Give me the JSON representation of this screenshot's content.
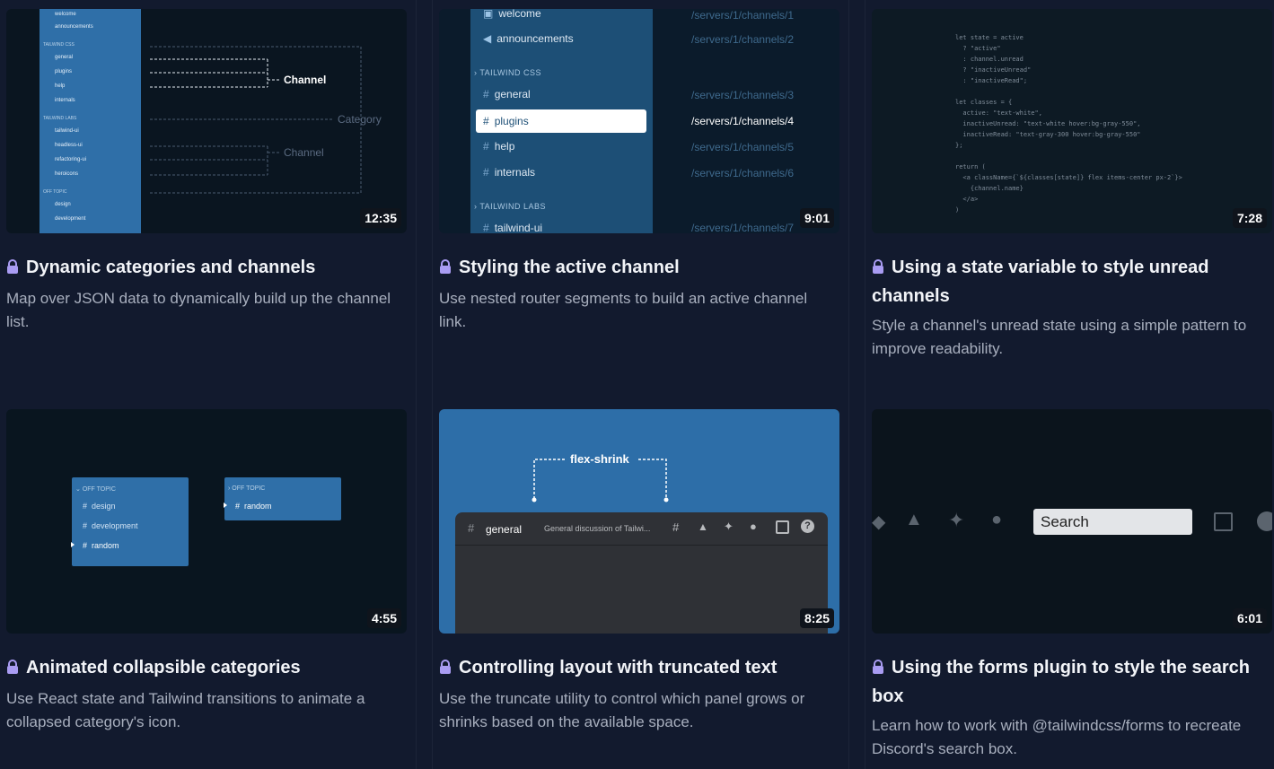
{
  "cards": [
    {
      "duration": "12:35",
      "title": "Dynamic categories and channels",
      "description": "Map over JSON data to dynamically build up the channel list.",
      "thumb": {
        "items": [
          "welcome",
          "announcements",
          "TAILWIND CSS",
          "general",
          "plugins",
          "help",
          "internals",
          "TAILWIND LABS",
          "tailwind-ui",
          "headless-ui",
          "refactoring-ui",
          "heroicons",
          "OFF TOPIC",
          "design",
          "development"
        ],
        "label_channel_1": "Channel",
        "label_category": "Category",
        "label_channel_2": "Channel"
      }
    },
    {
      "duration": "9:01",
      "title": "Styling the active channel",
      "description": "Use nested router segments to build an active channel link.",
      "thumb": {
        "welcome": "welcome",
        "announcements": "announcements",
        "cat1": "TAILWIND CSS",
        "general": "general",
        "plugins": "plugins",
        "help": "help",
        "internals": "internals",
        "cat2": "TAILWIND LABS",
        "tailwind_ui": "tailwind-ui",
        "paths": [
          "/servers/1/channels/1",
          "/servers/1/channels/2",
          "/servers/1/channels/3",
          "/servers/1/channels/4",
          "/servers/1/channels/5",
          "/servers/1/channels/6",
          "/servers/1/channels/7"
        ]
      }
    },
    {
      "duration": "7:28",
      "title": "Using a state variable to style unread channels",
      "description": "Style a channel's unread state using a simple pattern to improve readability.",
      "thumb": {
        "code": [
          "let state = active",
          "  ? \"active\"",
          "  : channel.unread",
          "  ? \"inactiveUnread\"",
          "  : \"inactiveRead\";",
          "",
          "let classes = {",
          "  active: \"text-white\",",
          "  inactiveUnread: \"text-white hover:bg-gray-550\",",
          "  inactiveRead: \"text-gray-300 hover:bg-gray-550\"",
          "};",
          "",
          "return (",
          "  <a className={`${classes[state]} flex items-center px-2`}>",
          "    {channel.name}",
          "  </a>",
          ")"
        ]
      }
    },
    {
      "duration": "4:55",
      "title": "Animated collapsible categories",
      "description": "Use React state and Tailwind transitions to animate a collapsed category's icon.",
      "thumb": {
        "cat": "OFF TOPIC",
        "items": [
          "design",
          "development",
          "random"
        ],
        "cat_collapsed": "OFF TOPIC",
        "collapsed_item": "random"
      }
    },
    {
      "duration": "8:25",
      "title": "Controlling layout with truncated text",
      "description": "Use the truncate utility to control which panel grows or shrinks based on the available space.",
      "thumb": {
        "label": "flex-shrink",
        "channel": "general",
        "topic": "General discussion of Tailwi..."
      }
    },
    {
      "duration": "6:01",
      "title": "Using the forms plugin to style the search box",
      "description": "Learn how to work with @tailwindcss/forms to recreate Discord's search box.",
      "thumb": {
        "search_value": "Search"
      }
    }
  ],
  "colors": {
    "page_bg": "#121a2e",
    "discord_blue": "#2f6fa8",
    "active_item_bg": "#ffffff"
  }
}
